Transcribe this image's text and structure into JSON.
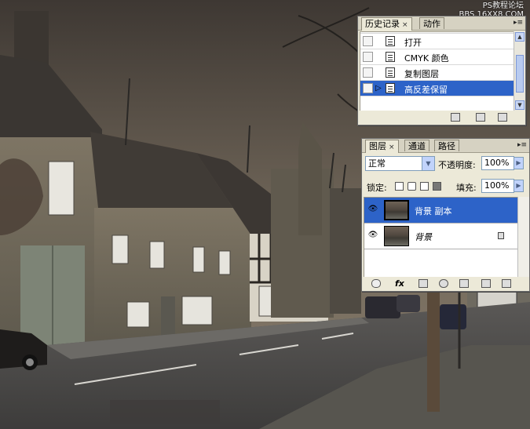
{
  "watermark": {
    "line1": "PS教程论坛",
    "line2": "BBS.16XX8.COM"
  },
  "history_panel": {
    "tabs": [
      {
        "label": "历史记录",
        "close": "×",
        "active": true
      },
      {
        "label": "动作",
        "active": false
      }
    ],
    "menu_icon": "panel-menu-icon",
    "items": [
      {
        "label": "打开",
        "icon": "history-state-icon"
      },
      {
        "label": "CMYK 颜色",
        "icon": "history-state-icon"
      },
      {
        "label": "复制图层",
        "icon": "history-state-icon"
      },
      {
        "label": "高反差保留",
        "icon": "history-state-icon",
        "selected": true
      }
    ],
    "footer_icons": [
      "new-document-icon",
      "snapshot-icon",
      "trash-icon"
    ]
  },
  "layers_panel": {
    "tabs": [
      {
        "label": "图层",
        "close": "×",
        "active": true
      },
      {
        "label": "通道",
        "active": false
      },
      {
        "label": "路径",
        "active": false
      }
    ],
    "blend_mode": "正常",
    "opacity_label": "不透明度:",
    "opacity_value": "100%",
    "lock_label": "锁定:",
    "fill_label": "填充:",
    "fill_value": "100%",
    "layers": [
      {
        "name": "背景 副本",
        "visible": true,
        "selected": true
      },
      {
        "name": "背景",
        "visible": true,
        "selected": false,
        "locked": true
      }
    ],
    "footer_icons": [
      "link-icon",
      "fx-icon",
      "mask-icon",
      "adjustment-icon",
      "group-folder-icon",
      "new-layer-icon",
      "trash-icon"
    ],
    "fx_label": "fx"
  },
  "colors": {
    "selection": "#2d63c8",
    "panel_bg": "#ece9d8"
  }
}
